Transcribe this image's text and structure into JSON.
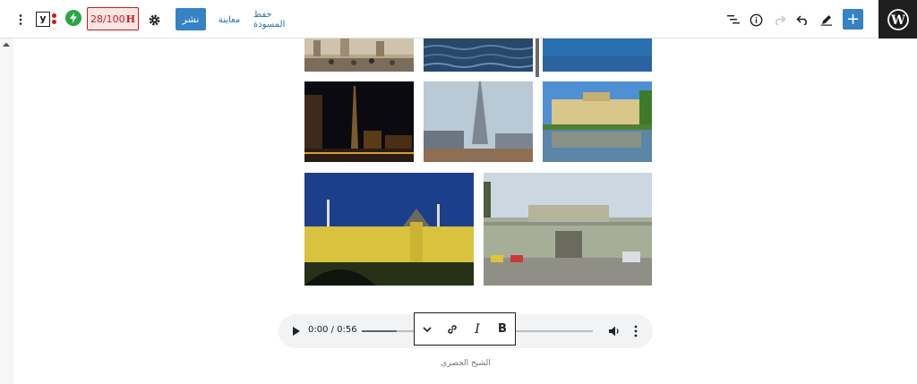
{
  "toolbar": {
    "add_label": "+",
    "publish_label": "نشر",
    "preview_label": "معاينة",
    "save_draft_label": "حفظ المسودة",
    "seo_score": "28/100",
    "seo_score_suffix": "H",
    "yoast_label": "y",
    "icons": [
      "wordpress-logo",
      "plus",
      "pencil",
      "undo",
      "redo",
      "info",
      "list-view",
      "gear",
      "amp-bolt",
      "yoast",
      "more-vertical"
    ]
  },
  "gallery": {
    "images": [
      {
        "name": "image-crowd-plaza"
      },
      {
        "name": "image-sea-waves"
      },
      {
        "name": "image-blue-water"
      },
      {
        "name": "image-night-skyline"
      },
      {
        "name": "image-burj-khalifa"
      },
      {
        "name": "image-palace-lake"
      },
      {
        "name": "image-yellow-palace"
      },
      {
        "name": "image-colonial-building"
      }
    ]
  },
  "audio": {
    "time": "0:00 / 0:56",
    "progress_fraction": 0.15,
    "caption": "الشيخ الحصري"
  },
  "format_toolbar": {
    "bold_label": "B",
    "italic_label": "I"
  },
  "colors": {
    "accent": "#3582c4",
    "link": "#2271b1",
    "error": "#cc1818",
    "amp_green": "#27a744"
  }
}
